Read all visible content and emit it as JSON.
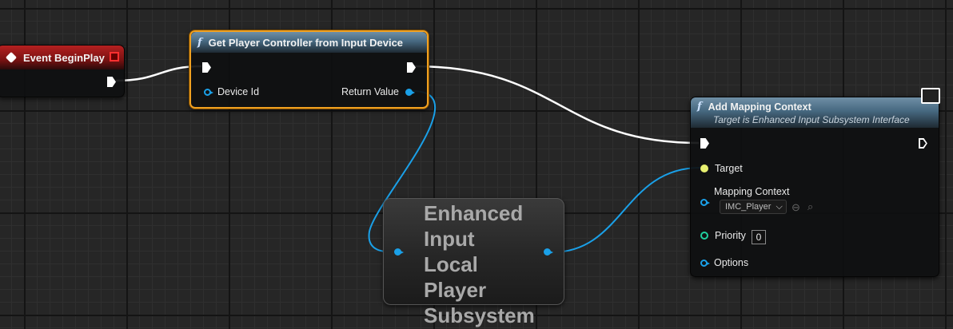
{
  "event_node": {
    "title": "Event BeginPlay",
    "icon": "event-diamond-icon",
    "color": "#b52020"
  },
  "get_pc_node": {
    "title": "Get Player Controller from Input Device",
    "icon": "function-icon",
    "pins": {
      "device_id": "Device Id",
      "return_value": "Return Value"
    },
    "selected": true,
    "selection_color": "#f0a020"
  },
  "subsystem_node": {
    "title": "Enhanced Input Local Player Subsystem"
  },
  "add_mapping_node": {
    "title": "Add Mapping Context",
    "subtitle": "Target is Enhanced Input Subsystem Interface",
    "icon": "function-icon",
    "pins": {
      "target": "Target",
      "mapping_context": "Mapping Context",
      "mapping_context_value": "IMC_Player",
      "priority": "Priority",
      "priority_value": "0",
      "options": "Options"
    }
  },
  "colors": {
    "object_pin": "#1aa0e8",
    "exec_wire": "#ffffff",
    "target_pin": "#e8f070",
    "priority_pin": "#20d0a0"
  }
}
